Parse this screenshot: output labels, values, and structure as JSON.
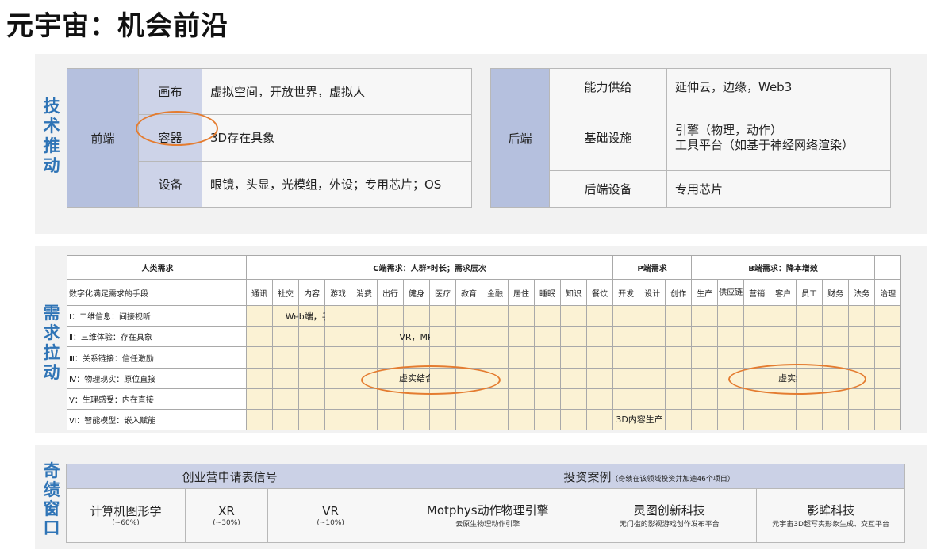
{
  "title": "元宇宙：机会前沿",
  "side_labels": {
    "tech": "技术推动",
    "demand": "需求拉动",
    "window": "奇绩窗口"
  },
  "tech_front": {
    "label": "前端",
    "rows": [
      {
        "key": "画布",
        "value": "虚拟空间，开放世界，虚拟人"
      },
      {
        "key": "容器",
        "value": "3D存在具象"
      },
      {
        "key": "设备",
        "value": "眼镜，头显，光模组，外设；专用芯片；OS"
      }
    ]
  },
  "tech_back": {
    "label": "后端",
    "rows": [
      {
        "key": "能力供给",
        "value": "延伸云，边缘，Web3"
      },
      {
        "key": "基础设施",
        "value": "引擎（物理，动作）",
        "value2": "工具平台（如基于神经网络渲染）"
      },
      {
        "key": "后端设备",
        "value": "专用芯片"
      }
    ]
  },
  "demand": {
    "headers": {
      "human": "人类需求",
      "c": "C端需求：人群*时长；需求层次",
      "p": "P端需求",
      "b": "B端需求：降本增效"
    },
    "means_label": "数字化满足需求的手段",
    "c_cols": [
      "通讯",
      "社交",
      "内容",
      "游戏",
      "消费",
      "出行",
      "健身",
      "医疗",
      "教育",
      "金融",
      "居住",
      "睡眠",
      "知识",
      "餐饮"
    ],
    "p_cols": [
      "开发",
      "设计",
      "创作"
    ],
    "b_cols": [
      "生产",
      "供应链",
      "营销",
      "客户",
      "员工",
      "财务",
      "法务",
      "治理"
    ],
    "highlighted": [
      "社交",
      "内容",
      "游戏",
      "创作",
      "营销",
      "员工"
    ],
    "rows": [
      {
        "label": "Ⅰ：二维信息：间接视听",
        "note": "Web端，手机（AR)"
      },
      {
        "label": "Ⅱ：三维体验：存在具象",
        "note": "VR，MR"
      },
      {
        "label": "Ⅲ：关系链接：信任激励",
        "note": ""
      },
      {
        "label": "Ⅳ：物理现实：原位直接",
        "note_c": "虚实结合",
        "note_b": "虚实结合"
      },
      {
        "label": "Ⅴ：生理感受：内在直接",
        "note": ""
      },
      {
        "label": "Ⅵ：智能模型：嵌入赋能",
        "note_p": "3D内容生产"
      }
    ]
  },
  "window": {
    "left_header": "创业营申请表信号",
    "right_header": "投资案例",
    "right_header_note": "（奇绩在该领域投资并加速46个项目）",
    "signals": [
      {
        "name": "计算机图形学",
        "pct": "(~60%)"
      },
      {
        "name": "XR",
        "pct": "(~30%)"
      },
      {
        "name": "VR",
        "pct": "(~10%)"
      }
    ],
    "cases": [
      {
        "name": "Motphys动作物理引擎",
        "desc": "云原生物理动作引擎"
      },
      {
        "name": "灵图创新科技",
        "desc": "无门槛的影视游戏创作发布平台"
      },
      {
        "name": "影眸科技",
        "desc": "元宇宙3D超写实形象生成、交互平台"
      }
    ]
  },
  "colors": {
    "accent_blue": "#2f74b6",
    "header_blue": "#b5c0de",
    "cell_yellow": "#fbf2d4",
    "highlight": "#fdf77c",
    "ellipse": "#e47c30"
  }
}
